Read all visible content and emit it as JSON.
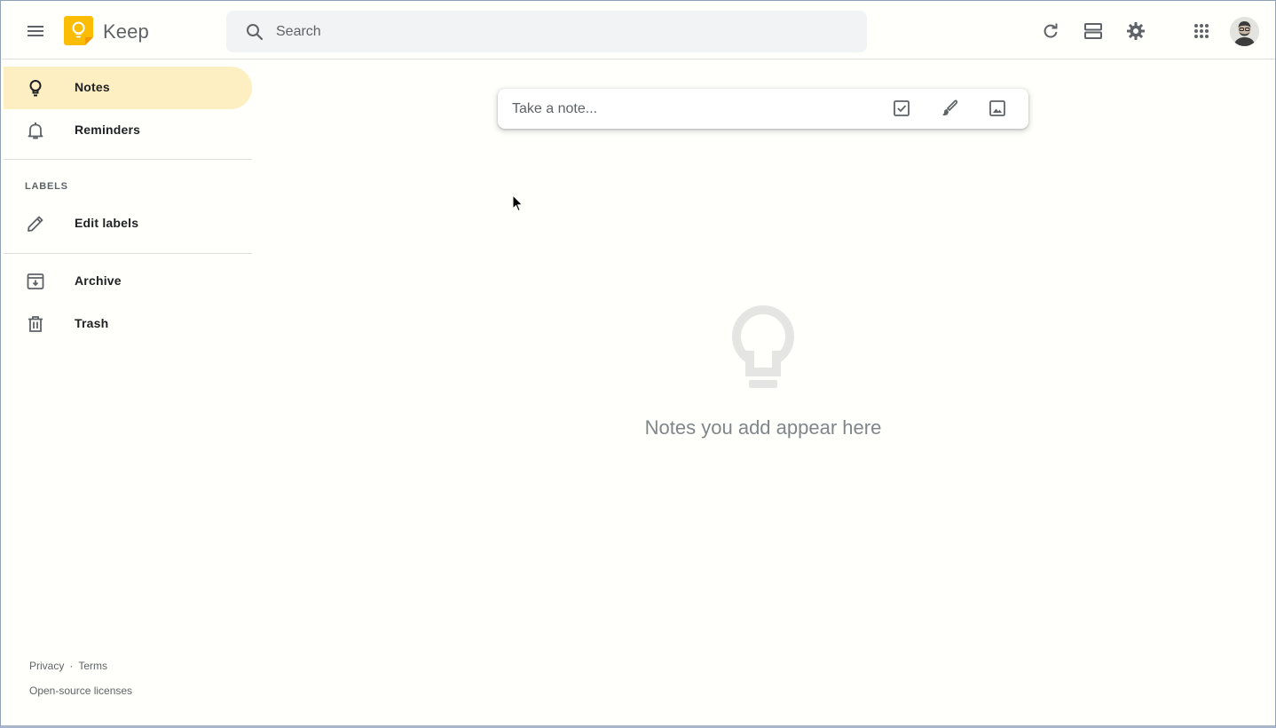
{
  "header": {
    "app_title": "Keep",
    "search_placeholder": "Search",
    "brand_color": "#fbbc04",
    "icons": [
      "menu-icon",
      "search-icon",
      "refresh-icon",
      "list-view-icon",
      "settings-icon",
      "apps-grid-icon"
    ]
  },
  "sidebar": {
    "items": [
      {
        "label": "Notes",
        "icon": "lightbulb-icon",
        "active": true
      },
      {
        "label": "Reminders",
        "icon": "bell-icon",
        "active": false
      }
    ],
    "labels_section": {
      "title": "LABELS",
      "edit_label": "Edit labels",
      "icon": "pencil-icon"
    },
    "secondary_items": [
      {
        "label": "Archive",
        "icon": "archive-icon"
      },
      {
        "label": "Trash",
        "icon": "trash-icon"
      }
    ],
    "footer": {
      "privacy": "Privacy",
      "separator": "·",
      "terms": "Terms",
      "licenses": "Open-source licenses"
    },
    "active_color": "#feefc3"
  },
  "main": {
    "take_note_placeholder": "Take a note...",
    "actions": [
      "checkbox-icon",
      "brush-icon",
      "image-icon"
    ],
    "empty_state": {
      "icon": "lightbulb-icon",
      "text": "Notes you add appear here"
    }
  }
}
